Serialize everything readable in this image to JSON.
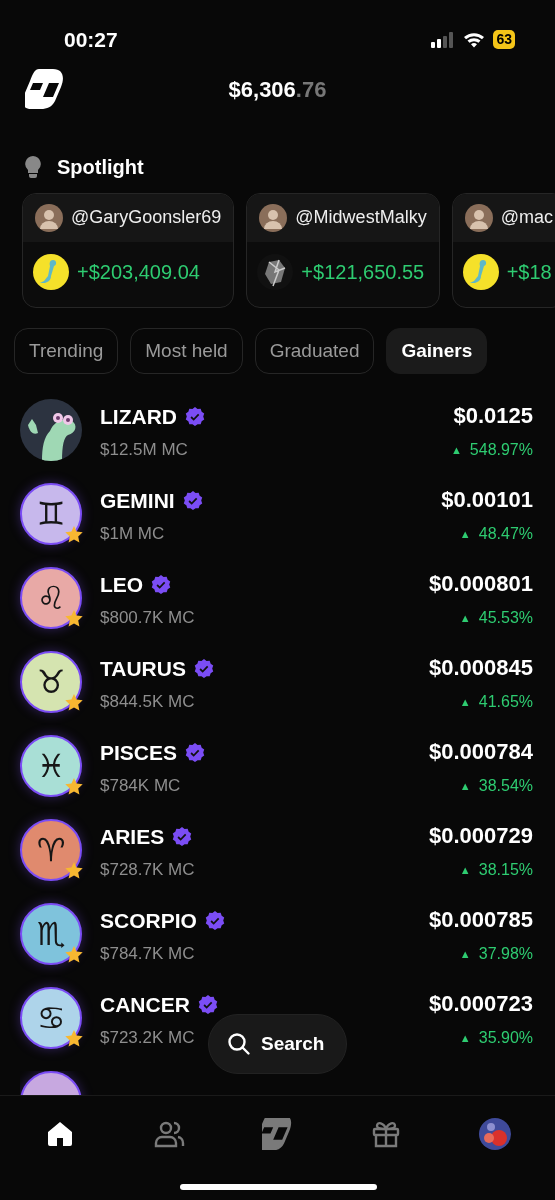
{
  "status_bar": {
    "time": "00:27",
    "battery": "63"
  },
  "header": {
    "balance_whole": "$6,306",
    "balance_cents": ".76"
  },
  "spotlight": {
    "title": "Spotlight",
    "cards": [
      {
        "handle": "@GaryGoonsler69",
        "gain": "+$203,409.04",
        "token": {
          "kind": "lizard"
        }
      },
      {
        "handle": "@MidwestMalky",
        "gain": "+$121,650.55",
        "token": {
          "kind": "crystal"
        }
      },
      {
        "handle": "@mac",
        "gain": "+$18",
        "token": {
          "kind": "lizard"
        }
      }
    ]
  },
  "tabs": [
    {
      "label": "Trending",
      "selected": false
    },
    {
      "label": "Most held",
      "selected": false
    },
    {
      "label": "Graduated",
      "selected": false
    },
    {
      "label": "Gainers",
      "selected": true
    }
  ],
  "tokens": [
    {
      "name": "LIZARD",
      "verified": true,
      "market_cap": "$12.5M MC",
      "price": "$0.0125",
      "change": "548.97%",
      "arrow": "▲",
      "starred": false
    },
    {
      "name": "GEMINI",
      "verified": true,
      "market_cap": "$1M MC",
      "price": "$0.00101",
      "change": "48.47%",
      "arrow": "▲",
      "starred": true,
      "avatar": {
        "kind": "symbol",
        "symbol": "♊",
        "color": "#c7b8ec"
      }
    },
    {
      "name": "LEO",
      "verified": true,
      "market_cap": "$800.7K MC",
      "price": "$0.000801",
      "change": "45.53%",
      "arrow": "▲",
      "starred": true,
      "avatar": {
        "kind": "symbol",
        "symbol": "♌",
        "color": "#e8a9a6"
      }
    },
    {
      "name": "TAURUS",
      "verified": true,
      "market_cap": "$844.5K MC",
      "price": "$0.000845",
      "change": "41.65%",
      "arrow": "▲",
      "starred": true,
      "avatar": {
        "kind": "symbol",
        "symbol": "♉",
        "color": "#d5e4b0"
      }
    },
    {
      "name": "PISCES",
      "verified": true,
      "market_cap": "$784K MC",
      "price": "$0.000784",
      "change": "38.54%",
      "arrow": "▲",
      "starred": true,
      "avatar": {
        "kind": "symbol",
        "symbol": "♓",
        "color": "#a9dfd6"
      }
    },
    {
      "name": "ARIES",
      "verified": true,
      "market_cap": "$728.7K MC",
      "price": "$0.000729",
      "change": "38.15%",
      "arrow": "▲",
      "starred": true,
      "avatar": {
        "kind": "symbol",
        "symbol": "♈",
        "color": "#e08a6e"
      }
    },
    {
      "name": "SCORPIO",
      "verified": true,
      "market_cap": "$784.7K MC",
      "price": "$0.000785",
      "change": "37.98%",
      "arrow": "▲",
      "starred": true,
      "avatar": {
        "kind": "symbol",
        "symbol": "♏",
        "color": "#7fc3dc"
      }
    },
    {
      "name": "CANCER",
      "verified": true,
      "market_cap": "$723.2K MC",
      "price": "$0.000723",
      "change": "35.90%",
      "arrow": "▲",
      "starred": true,
      "avatar": {
        "kind": "symbol",
        "symbol": "♋",
        "color": "#aed4ea"
      }
    }
  ],
  "search_button": {
    "label": "Search"
  },
  "bottom_nav": [
    {
      "kind": "home",
      "selected": true
    },
    {
      "kind": "people",
      "selected": false
    },
    {
      "kind": "logo",
      "selected": false
    },
    {
      "kind": "gift",
      "selected": false
    },
    {
      "kind": "profile",
      "selected": false
    }
  ]
}
